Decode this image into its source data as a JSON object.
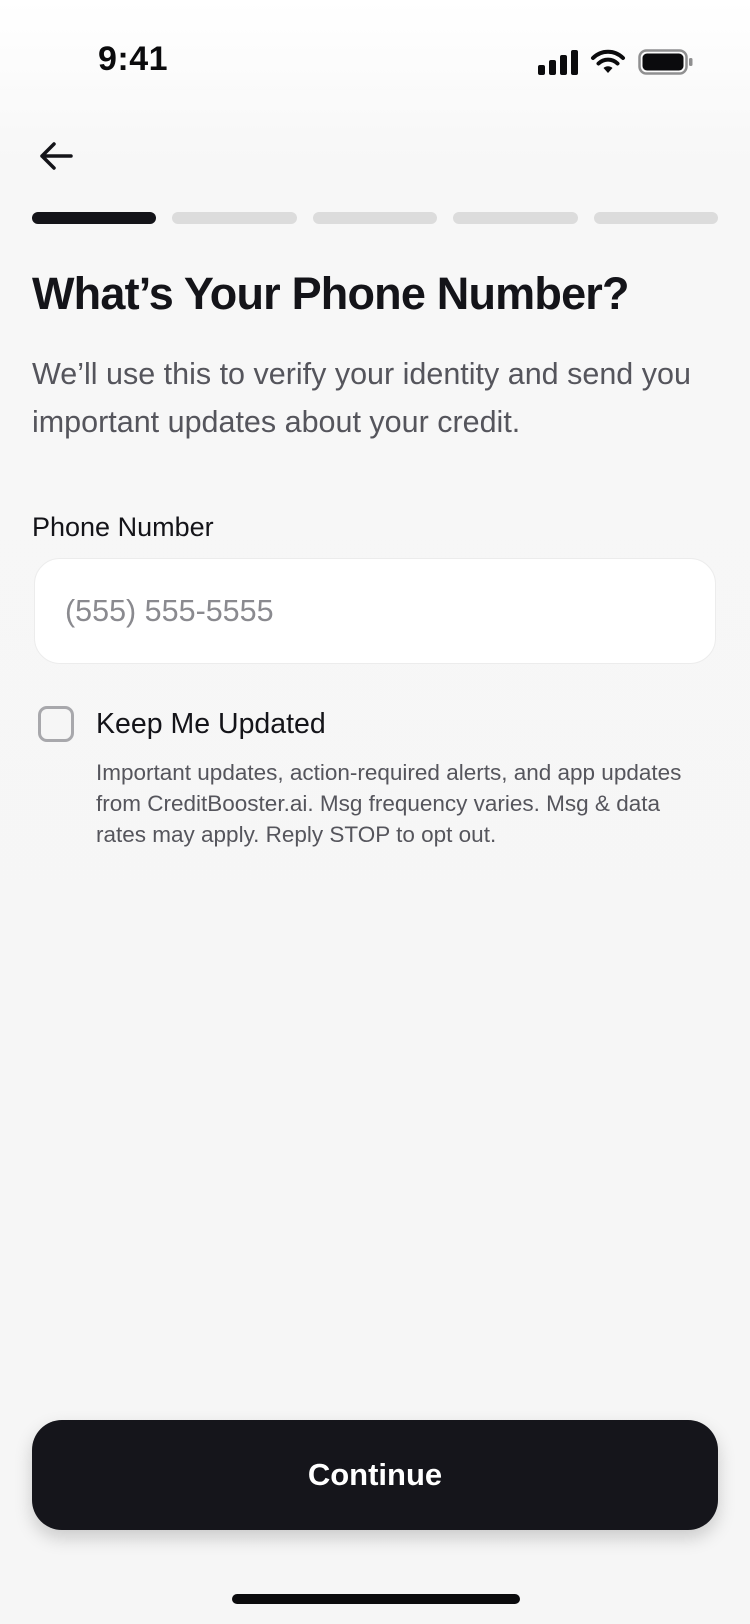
{
  "status_bar": {
    "time": "9:41",
    "icons": [
      "signal-icon",
      "wifi-icon",
      "battery-icon"
    ]
  },
  "navigation": {
    "back_icon": "arrow-left-icon"
  },
  "progress": {
    "total_steps": 5,
    "current_step": 1
  },
  "page": {
    "title": "What’s Your Phone Number?",
    "subtitle": "We’ll use this to verify your identity and send you important updates about your credit."
  },
  "phone_field": {
    "label": "Phone Number",
    "value": "",
    "placeholder": "(555) 555-5555"
  },
  "opt_in": {
    "checked": false,
    "label": "Keep Me Updated",
    "description": "Important updates, action-required alerts, and app updates from CreditBooster.ai. Msg frequency varies. Msg & data rates may apply. Reply STOP to opt out."
  },
  "actions": {
    "continue_label": "Continue"
  },
  "colors": {
    "primary": "#15151b",
    "progress_inactive": "#dcdcdc",
    "background": "#f6f6f6",
    "muted_text": "#55555c"
  }
}
